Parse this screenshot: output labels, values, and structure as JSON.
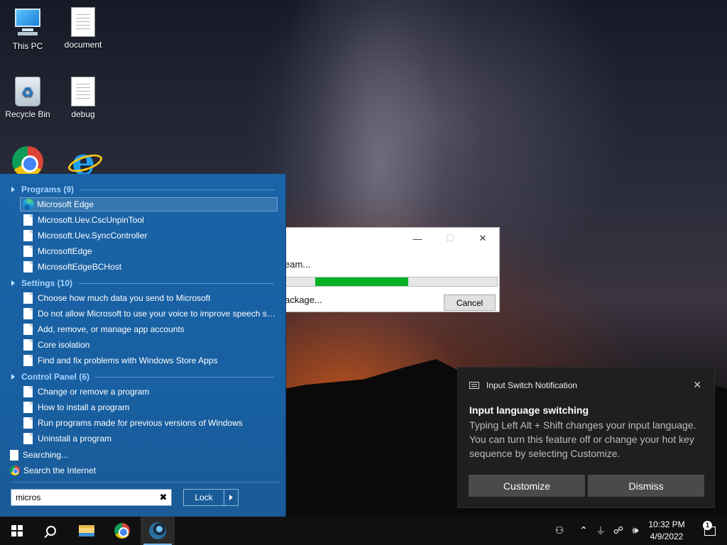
{
  "desktop": {
    "icons": [
      {
        "label": "This PC",
        "icon": "computer-icon"
      },
      {
        "label": "document",
        "icon": "document-icon"
      },
      {
        "label": "Recycle Bin",
        "icon": "recycle-bin-icon"
      },
      {
        "label": "debug",
        "icon": "document-icon"
      },
      {
        "label": "",
        "icon": "chrome-icon"
      },
      {
        "label": "",
        "icon": "internet-explorer-icon"
      }
    ]
  },
  "dialog": {
    "line1": "eam...",
    "line2": "ackage...",
    "progress": 0.58,
    "cancel_label": "Cancel",
    "minimize_glyph": "—",
    "maximize_glyph": "☐",
    "close_glyph": "✕"
  },
  "start_menu": {
    "groups": [
      {
        "name": "Programs (9)",
        "items": [
          "Microsoft Edge",
          "Microsoft.Uev.CscUnpinTool",
          "Microsoft.Uev.SyncController",
          "MicrosoftEdge",
          "MicrosoftEdgeBCHost"
        ]
      },
      {
        "name": "Settings (10)",
        "items": [
          "Choose how much data you send to Microsoft",
          "Do not allow Microsoft to use your voice to improve speech se...",
          "Add, remove, or manage app accounts",
          "Core isolation",
          "Find and fix problems with Windows Store Apps"
        ]
      },
      {
        "name": "Control Panel (6)",
        "items": [
          "Change or remove a program",
          "How to install a program",
          "Run programs made for previous versions of Windows",
          "Uninstall a program"
        ]
      }
    ],
    "searching_label": "Searching...",
    "search_internet_label": "Search the Internet",
    "search_value": "micros",
    "clear_glyph": "✖",
    "lock_label": "Lock"
  },
  "toast": {
    "app_name": "Input Switch Notification",
    "close_glyph": "✕",
    "title": "Input language switching",
    "body": "Typing Left Alt + Shift changes your input language. You can turn this feature off or change your hot key sequence by selecting Customize.",
    "customize_label": "Customize",
    "dismiss_label": "Dismiss"
  },
  "taskbar": {
    "people_glyph": "⚇",
    "chevron_glyph": "⌃",
    "network_glyph": "☍",
    "volume_glyph": "🕪",
    "time": "10:32 PM",
    "date": "4/9/2022",
    "notification_count": "1"
  }
}
